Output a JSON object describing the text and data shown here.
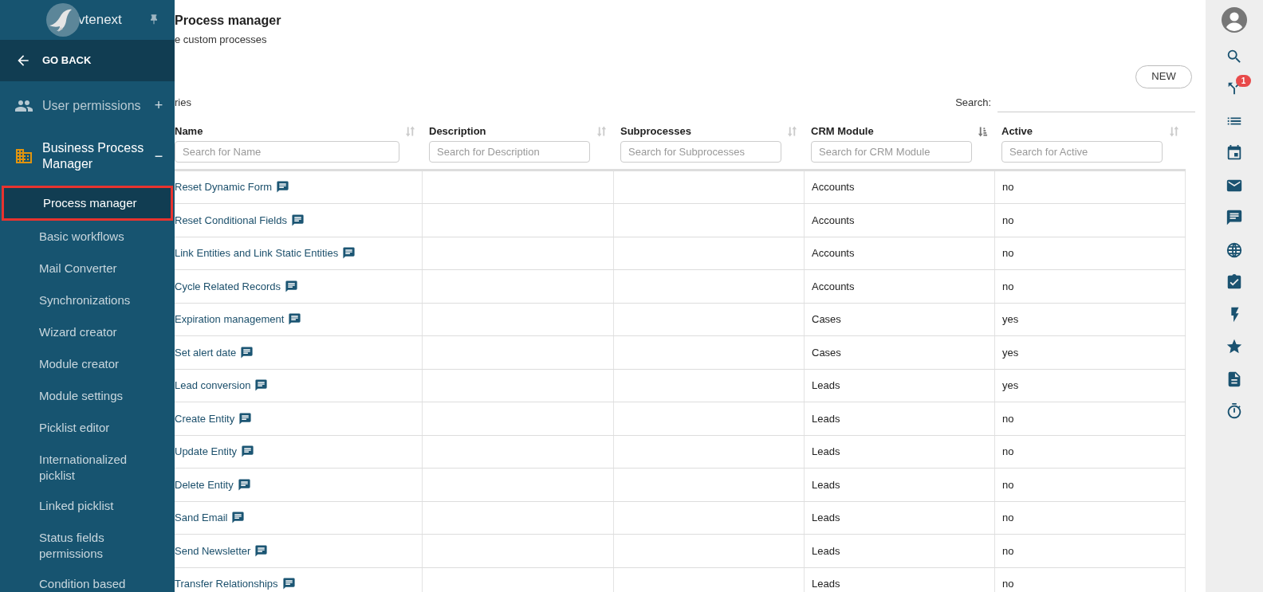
{
  "sidebar": {
    "logo_text": "vtenext",
    "back": "GO BACK",
    "sections": [
      {
        "label": "User permissions",
        "toggle": "+",
        "expanded": false
      },
      {
        "label": "Business Process Manager",
        "toggle": "−",
        "expanded": true,
        "children": [
          {
            "label": "Process manager",
            "selected": true
          },
          {
            "label": "Basic workflows",
            "selected": false
          },
          {
            "label": "Mail Converter",
            "selected": false
          },
          {
            "label": "Synchronizations",
            "selected": false
          },
          {
            "label": "Wizard creator",
            "selected": false
          },
          {
            "label": "Module creator",
            "selected": false
          },
          {
            "label": "Module settings",
            "selected": false
          },
          {
            "label": "Picklist editor",
            "selected": false
          },
          {
            "label": "Internationalized picklist",
            "selected": false
          },
          {
            "label": "Linked picklist",
            "selected": false
          },
          {
            "label": "Status fields permissions",
            "selected": false
          },
          {
            "label": "Condition based",
            "selected": false
          }
        ]
      }
    ]
  },
  "header": {
    "title": "Process manager",
    "subtitle": "e custom processes"
  },
  "new_button": "NEW",
  "entries_label": "ries",
  "search_label": "Search:",
  "table": {
    "columns": [
      {
        "label": "Name",
        "placeholder": "Search for Name",
        "sorted": false
      },
      {
        "label": "Description",
        "placeholder": "Search for Description",
        "sorted": false
      },
      {
        "label": "Subprocesses",
        "placeholder": "Search for Subprocesses",
        "sorted": false
      },
      {
        "label": "CRM Module",
        "placeholder": "Search for CRM Module",
        "sorted": true
      },
      {
        "label": "Active",
        "placeholder": "Search for Active",
        "sorted": false
      }
    ],
    "rows": [
      {
        "name": "Reset Dynamic Form",
        "module": "Accounts",
        "active": "no"
      },
      {
        "name": "Reset Conditional Fields",
        "module": "Accounts",
        "active": "no"
      },
      {
        "name": "Link Entities and Link Static Entities",
        "module": "Accounts",
        "active": "no"
      },
      {
        "name": "Cycle Related Records",
        "module": "Accounts",
        "active": "no"
      },
      {
        "name": "Expiration management",
        "module": "Cases",
        "active": "yes"
      },
      {
        "name": "Set alert date",
        "module": "Cases",
        "active": "yes"
      },
      {
        "name": "Lead conversion",
        "module": "Leads",
        "active": "yes"
      },
      {
        "name": "Create Entity",
        "module": "Leads",
        "active": "no"
      },
      {
        "name": "Update Entity",
        "module": "Leads",
        "active": "no"
      },
      {
        "name": "Delete Entity",
        "module": "Leads",
        "active": "no"
      },
      {
        "name": "Sand Email",
        "module": "Leads",
        "active": "no"
      },
      {
        "name": "Send Newsletter",
        "module": "Leads",
        "active": "no"
      },
      {
        "name": "Transfer Relationships",
        "module": "Leads",
        "active": "no"
      }
    ]
  },
  "rail": {
    "badge": "1"
  }
}
